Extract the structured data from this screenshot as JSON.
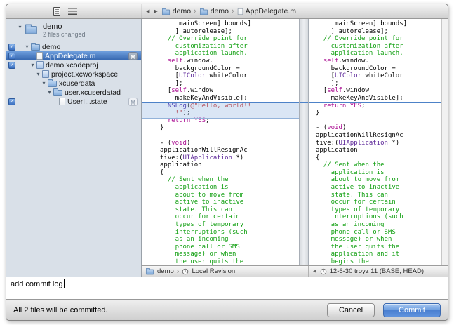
{
  "icons": {
    "back": "◀",
    "forward": "▶",
    "separator": "›",
    "disclosure": "▾",
    "check": "✓"
  },
  "toolbar": {
    "breadcrumb": [
      {
        "icon": "folder-icon",
        "label": "demo"
      },
      {
        "icon": "folder-icon",
        "label": "demo"
      },
      {
        "icon": "file-icon",
        "label": "AppDelegate.m"
      }
    ]
  },
  "sidebar": {
    "root": {
      "label": "demo",
      "subtitle": "2 files changed"
    },
    "items": [
      {
        "label": "demo",
        "icon": "folder-icon",
        "checkbox": true
      },
      {
        "label": "AppDelegate.m",
        "icon": "file-icon",
        "checkbox": true,
        "badge": "M",
        "selected": true
      },
      {
        "label": "demo.xcodeproj",
        "icon": "project-icon",
        "checkbox": true
      },
      {
        "label": "project.xcworkspace",
        "icon": "workspace-icon"
      },
      {
        "label": "xcuserdata",
        "icon": "folder-icon"
      },
      {
        "label": "user.xcuserdatad",
        "icon": "folder-icon"
      },
      {
        "label": "UserI...state",
        "icon": "file-icon",
        "checkbox": true,
        "badge": "M"
      }
    ]
  },
  "diff": {
    "left": {
      "footer": {
        "project": "demo",
        "revision": "Local Revision"
      },
      "lines": [
        [
          [
            "p",
            "     mainScreen] bounds]"
          ]
        ],
        [
          [
            "p",
            "    ] autorelease];"
          ]
        ],
        [
          [
            "c",
            "  // Override point for"
          ]
        ],
        [
          [
            "c",
            "    customization after"
          ]
        ],
        [
          [
            "c",
            "    application launch."
          ]
        ],
        [
          [
            "p",
            "  "
          ],
          [
            "k",
            "self"
          ],
          [
            "p",
            ".window."
          ]
        ],
        [
          [
            "p",
            "    backgroundColor ="
          ]
        ],
        [
          [
            "p",
            "    ["
          ],
          [
            "t",
            "UIColor"
          ],
          [
            "p",
            " whiteColor"
          ]
        ],
        [
          [
            "p",
            "    ];"
          ]
        ],
        [
          [
            "p",
            "  ["
          ],
          [
            "k",
            "self"
          ],
          [
            "p",
            ".window"
          ]
        ],
        [
          [
            "p",
            "    makeKeyAndVisible];"
          ]
        ],
        [
          [
            "p",
            "  "
          ],
          [
            "f",
            "NSLog"
          ],
          [
            "p",
            "("
          ],
          [
            "s",
            "@\"Hello, world!!"
          ]
        ],
        [
          [
            "s",
            "    !\""
          ],
          [
            "p",
            ");"
          ]
        ],
        [
          [
            "p",
            "  "
          ],
          [
            "k",
            "return"
          ],
          [
            "p",
            " "
          ],
          [
            "k",
            "YES"
          ],
          [
            "p",
            ";"
          ]
        ],
        [
          [
            "p",
            "}"
          ]
        ],
        [],
        [
          [
            "p",
            "- ("
          ],
          [
            "k",
            "void"
          ],
          [
            "p",
            ")"
          ]
        ],
        [
          [
            "p",
            "applicationWillResignAc"
          ]
        ],
        [
          [
            "p",
            "tive:("
          ],
          [
            "t",
            "UIApplication"
          ],
          [
            "p",
            " *)"
          ]
        ],
        [
          [
            "p",
            "application"
          ]
        ],
        [
          [
            "p",
            "{"
          ]
        ],
        [
          [
            "c",
            "  // Sent when the"
          ]
        ],
        [
          [
            "c",
            "    application is"
          ]
        ],
        [
          [
            "c",
            "    about to move from"
          ]
        ],
        [
          [
            "c",
            "    active to inactive"
          ]
        ],
        [
          [
            "c",
            "    state. This can"
          ]
        ],
        [
          [
            "c",
            "    occur for certain"
          ]
        ],
        [
          [
            "c",
            "    types of temporary"
          ]
        ],
        [
          [
            "c",
            "    interruptions (such"
          ]
        ],
        [
          [
            "c",
            "    as an incoming"
          ]
        ],
        [
          [
            "c",
            "    phone call or SMS"
          ]
        ],
        [
          [
            "c",
            "    message) or when"
          ]
        ],
        [
          [
            "c",
            "    the user quits the"
          ]
        ]
      ]
    },
    "right": {
      "footer": {
        "revision": "12-6-30 troyz 11 (BASE, HEAD)"
      },
      "lines": [
        [
          [
            "p",
            "     mainScreen] bounds]"
          ]
        ],
        [
          [
            "p",
            "    ] autorelease];"
          ]
        ],
        [
          [
            "c",
            "  // Override point for"
          ]
        ],
        [
          [
            "c",
            "    customization after"
          ]
        ],
        [
          [
            "c",
            "    application launch."
          ]
        ],
        [
          [
            "p",
            "  "
          ],
          [
            "k",
            "self"
          ],
          [
            "p",
            ".window."
          ]
        ],
        [
          [
            "p",
            "    backgroundColor ="
          ]
        ],
        [
          [
            "p",
            "    ["
          ],
          [
            "t",
            "UIColor"
          ],
          [
            "p",
            " whiteColor"
          ]
        ],
        [
          [
            "p",
            "    ];"
          ]
        ],
        [
          [
            "p",
            "  ["
          ],
          [
            "k",
            "self"
          ],
          [
            "p",
            ".window"
          ]
        ],
        [
          [
            "p",
            "    makeKeyAndVisible];"
          ]
        ],
        [
          [
            "p",
            "  "
          ],
          [
            "k",
            "return"
          ],
          [
            "p",
            " "
          ],
          [
            "k",
            "YES"
          ],
          [
            "p",
            ";"
          ]
        ],
        [
          [
            "p",
            "}"
          ]
        ],
        [],
        [
          [
            "p",
            "- ("
          ],
          [
            "k",
            "void"
          ],
          [
            "p",
            ")"
          ]
        ],
        [
          [
            "p",
            "applicationWillResignAc"
          ]
        ],
        [
          [
            "p",
            "tive:("
          ],
          [
            "t",
            "UIApplication"
          ],
          [
            "p",
            " *)"
          ]
        ],
        [
          [
            "p",
            "application"
          ]
        ],
        [
          [
            "p",
            "{"
          ]
        ],
        [
          [
            "c",
            "  // Sent when the"
          ]
        ],
        [
          [
            "c",
            "    application is"
          ]
        ],
        [
          [
            "c",
            "    about to move from"
          ]
        ],
        [
          [
            "c",
            "    active to inactive"
          ]
        ],
        [
          [
            "c",
            "    state. This can"
          ]
        ],
        [
          [
            "c",
            "    occur for certain"
          ]
        ],
        [
          [
            "c",
            "    types of temporary"
          ]
        ],
        [
          [
            "c",
            "    interruptions (such"
          ]
        ],
        [
          [
            "c",
            "    as an incoming"
          ]
        ],
        [
          [
            "c",
            "    phone call or SMS"
          ]
        ],
        [
          [
            "c",
            "    message) or when"
          ]
        ],
        [
          [
            "c",
            "    the user quits the"
          ]
        ],
        [
          [
            "c",
            "    application and it"
          ]
        ],
        [
          [
            "c",
            "    begins the"
          ]
        ]
      ]
    }
  },
  "commit": {
    "message": "add commit log",
    "status": "All 2 files will be committed.",
    "cancel_label": "Cancel",
    "commit_label": "Commit"
  },
  "colors": {
    "selection_blue": "#3465ae",
    "diff_line_blue": "#4d82c8",
    "comment_green": "#12a012",
    "keyword_pink": "#aa0d91",
    "string_red": "#c41a16",
    "type_purple": "#5c2699",
    "commit_button_blue": "#4a7fd0"
  }
}
